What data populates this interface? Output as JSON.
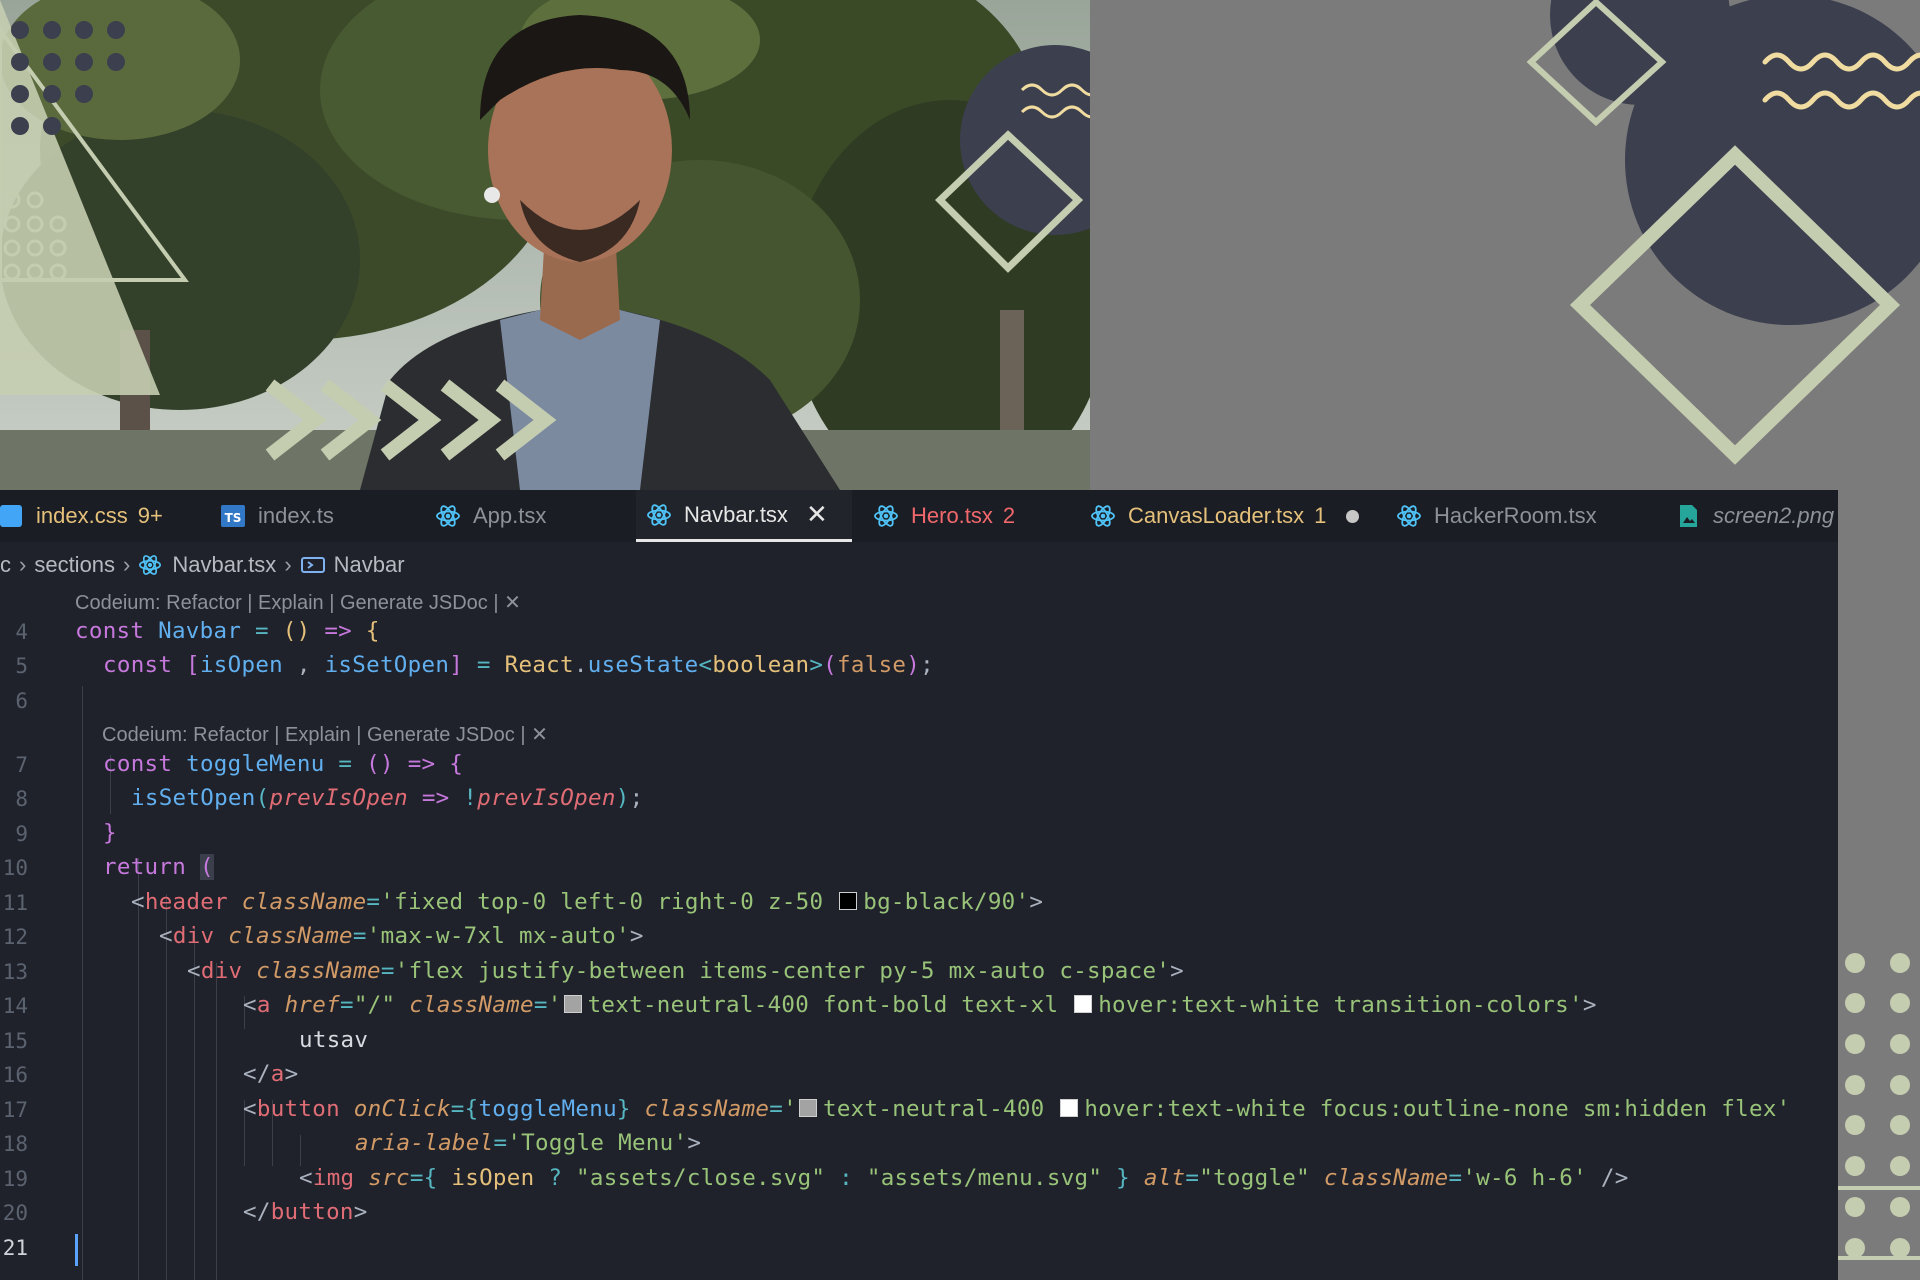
{
  "colors": {
    "background": "#7b7b7b",
    "navy_shape": "#3c3f4e",
    "sage_shape": "#c5cdb0",
    "zigzag": "#f0dca0",
    "editor_bg": "#1f222a"
  },
  "tabs": [
    {
      "label": "index.css",
      "badge": "9+",
      "icon": "css-file-icon",
      "state": "warning"
    },
    {
      "label": "index.ts",
      "badge": "",
      "icon": "typescript-file-icon",
      "state": "normal"
    },
    {
      "label": "App.tsx",
      "badge": "",
      "icon": "react-file-icon",
      "state": "normal"
    },
    {
      "label": "Navbar.tsx",
      "badge": "",
      "icon": "react-file-icon",
      "state": "active",
      "close": "✕"
    },
    {
      "label": "Hero.tsx",
      "badge": "2",
      "icon": "react-file-icon",
      "state": "error"
    },
    {
      "label": "CanvasLoader.tsx",
      "badge": "1",
      "icon": "react-file-icon",
      "state": "modified"
    },
    {
      "label": "HackerRoom.tsx",
      "badge": "",
      "icon": "react-file-icon",
      "state": "normal"
    },
    {
      "label": "screen2.png",
      "badge": "",
      "icon": "image-file-icon",
      "state": "preview"
    }
  ],
  "breadcrumb": {
    "root": "c",
    "folder": "sections",
    "file": "Navbar.tsx",
    "symbol": "Navbar"
  },
  "code_lens": {
    "line4": "Codeium: Refactor | Explain | Generate JSDoc | ✕",
    "line7": "Codeium: Refactor | Explain | Generate JSDoc | ✕"
  },
  "line_numbers": [
    "4",
    "5",
    "6",
    "7",
    "8",
    "9",
    "10",
    "11",
    "12",
    "13",
    "14",
    "15",
    "16",
    "17",
    "18",
    "19",
    "20",
    "21"
  ],
  "code": {
    "l4": {
      "kw": "const",
      "name": "Navbar",
      "op": "=",
      "paren": "()",
      "arrow": "=>",
      "brace": "{"
    },
    "l5": {
      "kw": "const",
      "lb": "[",
      "a": "isOpen",
      "comma": " , ",
      "b": "isSetOpen",
      "rb": "]",
      "eq": "=",
      "obj": "React",
      "dot": ".",
      "fn": "useState",
      "lt": "<",
      "type": "boolean",
      "gt": ">",
      "lp": "(",
      "val": "false",
      "rp": ")",
      "semi": ";"
    },
    "l7": {
      "kw": "const",
      "name": "toggleMenu",
      "op": "=",
      "paren": "()",
      "arrow": "=>",
      "brace": "{"
    },
    "l8": {
      "fn": "isSetOpen",
      "lp": "(",
      "param": "prevIsOpen",
      "arrow": "=>",
      "not": "!",
      "param2": "prevIsOpen",
      "rp": ")",
      "semi": ";"
    },
    "l9": {
      "brace": "}"
    },
    "l10": {
      "kw": "return",
      "paren": "("
    },
    "l11": {
      "open": "<",
      "tag": "header",
      "attr": "className",
      "eq": "=",
      "s1": "'fixed top-0 left-0 right-0 z-50 ",
      "s2": "bg-black/90'",
      "close": ">",
      "swatch": "#000000"
    },
    "l12": {
      "open": "<",
      "tag": "div",
      "attr": "className",
      "eq": "=",
      "str": "'max-w-7xl mx-auto'",
      "close": ">"
    },
    "l13": {
      "open": "<",
      "tag": "div",
      "attr": "className",
      "eq": "=",
      "str": "'flex justify-between items-center py-5 mx-auto c-space'",
      "close": ">"
    },
    "l14": {
      "open": "<",
      "tag": "a",
      "attr1": "href",
      "eq1": "=",
      "v1": "\"/\"",
      "attr2": "className",
      "eq2": "=",
      "q": "'",
      "s1": "text-neutral-400 font-bold text-xl ",
      "s2": "hover:text-white transition-colors'",
      "close": ">",
      "swatch1": "#a3a3a3",
      "swatch2": "#ffffff"
    },
    "l15": {
      "text": "utsav"
    },
    "l16": {
      "open": "</",
      "tag": "a",
      "close": ">"
    },
    "l17": {
      "open": "<",
      "tag": "button",
      "attr1": "onClick",
      "eq1": "=",
      "lb": "{",
      "fn": "toggleMenu",
      "rb": "}",
      "attr2": "className",
      "eq2": "=",
      "q": "'",
      "s1": "text-neutral-400 ",
      "s2": "hover:text-white focus:outline-none sm:hidden flex'",
      "swatch1": "#a3a3a3",
      "swatch2": "#ffffff"
    },
    "l18": {
      "attr": "aria-label",
      "eq": "=",
      "str": "'Toggle Menu'",
      "close": ">"
    },
    "l19": {
      "open": "<",
      "tag": "img",
      "attr1": "src",
      "eq1": "=",
      "lb": "{",
      "var": "isOpen",
      "q": "?",
      "s1": "\"assets/close.svg\"",
      "colon": ":",
      "s2": "\"assets/menu.svg\"",
      "rb": "}",
      "attr2": "alt",
      "eq2": "=",
      "s3": "\"toggle\"",
      "attr3": "className",
      "eq3": "=",
      "s4": "'w-6 h-6'",
      "close": "/>"
    },
    "l20": {
      "open": "</",
      "tag": "button",
      "close": ">"
    }
  }
}
